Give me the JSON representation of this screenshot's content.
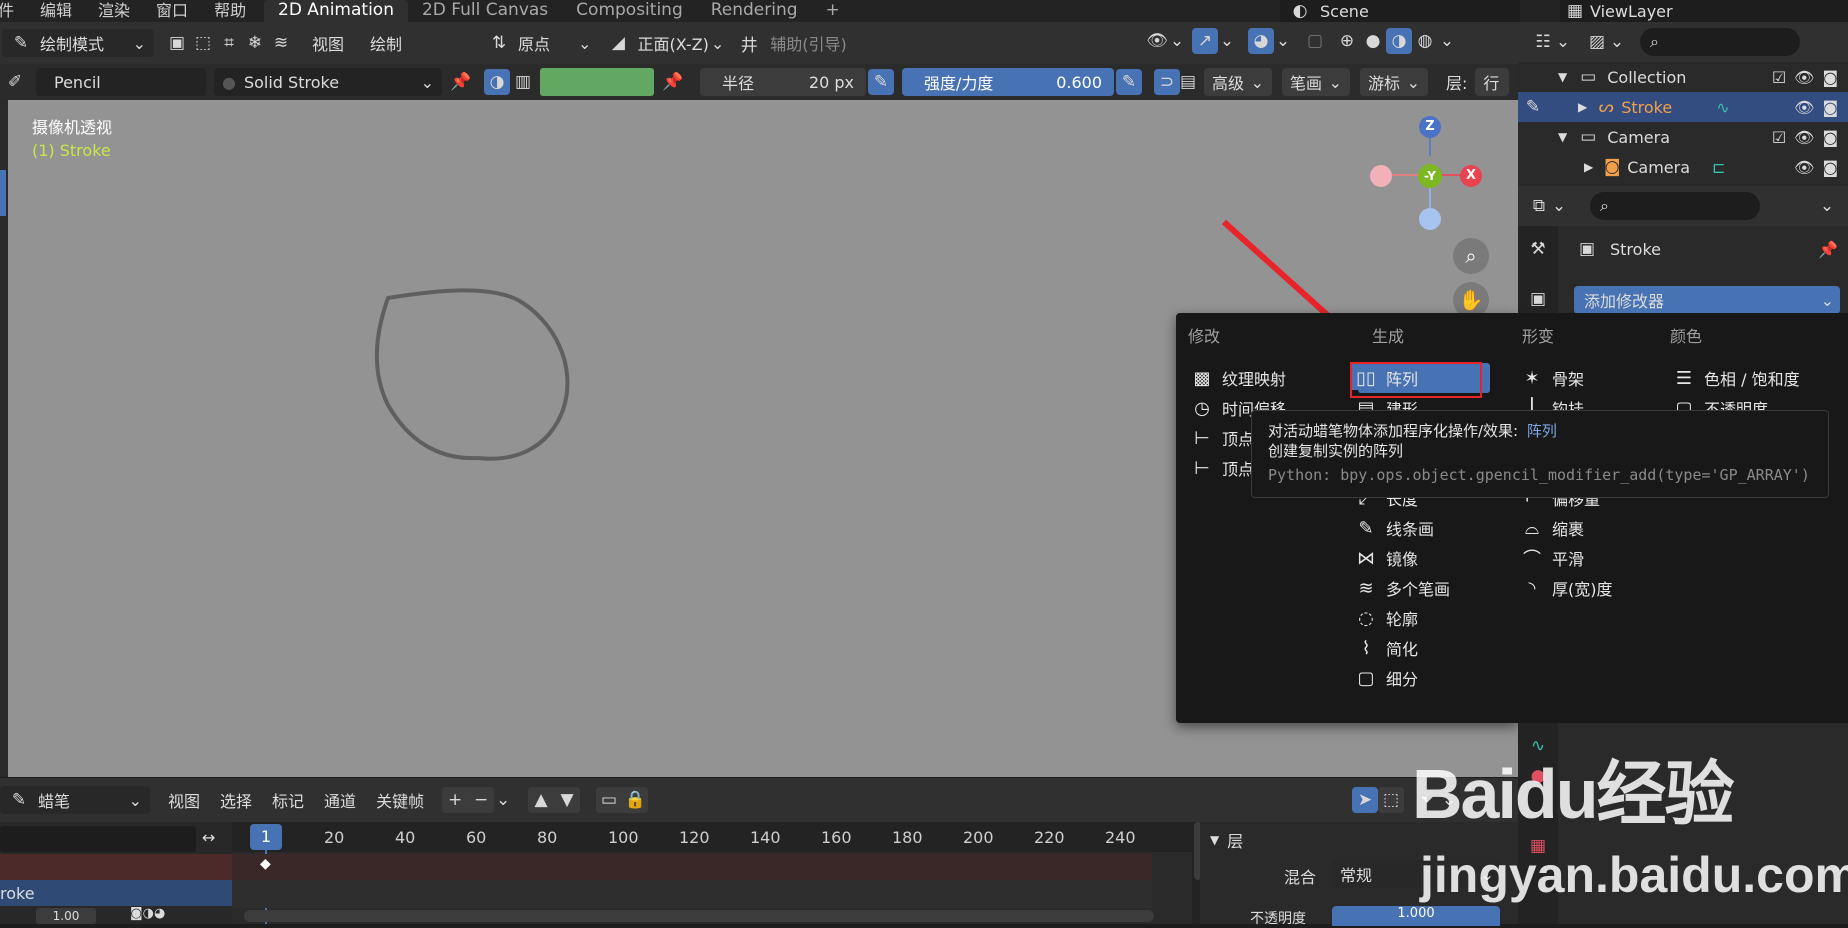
{
  "topbar": {
    "menus": [
      "件",
      "编辑",
      "渲染",
      "窗口",
      "帮助"
    ],
    "tabs": [
      "2D Animation",
      "2D Full Canvas",
      "Compositing",
      "Rendering"
    ],
    "add_tab": "+",
    "scene": "Scene",
    "view_layer": "ViewLayer"
  },
  "header1": {
    "mode": "绘制模式",
    "view": "视图",
    "draw": "绘制",
    "origin": "原点",
    "front": "正面(X-Z)",
    "guide": "辅助(引导)"
  },
  "header2": {
    "brush": "Pencil",
    "material": "Solid Stroke",
    "radius_label": "半径",
    "radius_value": "20 px",
    "strength_label": "强度/力度",
    "strength_value": "0.600",
    "advanced": "高级",
    "stroke": "笔画",
    "cursor": "游标",
    "layer": "层:",
    "row": "行"
  },
  "viewport": {
    "title": "摄像机透视",
    "object": "(1) Stroke",
    "gizmo_z": "Z",
    "gizmo_y": "-Y",
    "gizmo_x": "X"
  },
  "outliner": {
    "collection": "Collection",
    "stroke": "Stroke",
    "camera_coll": "Camera",
    "camera_obj": "Camera"
  },
  "properties": {
    "object_name": "Stroke",
    "add_modifier": "添加修改器"
  },
  "popup": {
    "col_modify": "修改",
    "col_generate": "生成",
    "col_deform": "形变",
    "col_color": "颜色",
    "modify_items": [
      "纹理映射",
      "时间偏移",
      "顶点",
      "顶点"
    ],
    "generate_items": [
      "阵列",
      "建形",
      "长度",
      "线条画",
      "镜像",
      "多个笔画",
      "轮廓",
      "简化",
      "细分"
    ],
    "deform_items": [
      "骨架",
      "钩挂",
      "偏移量",
      "缩裹",
      "平滑",
      "厚(宽)度"
    ],
    "color_items": [
      "色相 / 饱和度",
      "不透明度"
    ]
  },
  "tooltip": {
    "line1_prefix": "对活动蜡笔物体添加程序化操作/效果:",
    "line1_value": "阵列",
    "line2": "创建复制实例的阵列",
    "python": "Python: bpy.ops.object.gpencil_modifier_add(type='GP_ARRAY')"
  },
  "timeline": {
    "mode": "蜡笔",
    "view": "视图",
    "select": "选择",
    "marker": "标记",
    "channel": "通道",
    "keyframe": "关键帧",
    "current_frame": "1",
    "frames": [
      "20",
      "40",
      "60",
      "80",
      "100",
      "120",
      "140",
      "160",
      "180",
      "200",
      "220",
      "240"
    ],
    "layer_name": "roke",
    "opacity_num": "1.00"
  },
  "layer_panel": {
    "title": "层",
    "blend_label": "混合",
    "blend_value": "常规",
    "opacity_label": "不透明度",
    "opacity_value": "1.000"
  },
  "watermark": {
    "brand": "Baidu经验",
    "url": "jingyan.baidu.com"
  },
  "colors": {
    "accent_blue": "#4772b3",
    "highlight_red": "#e8242b",
    "stroke_active": "#f0a04b",
    "viewport_bg": "#939393",
    "object_text": "#c8e64a"
  }
}
